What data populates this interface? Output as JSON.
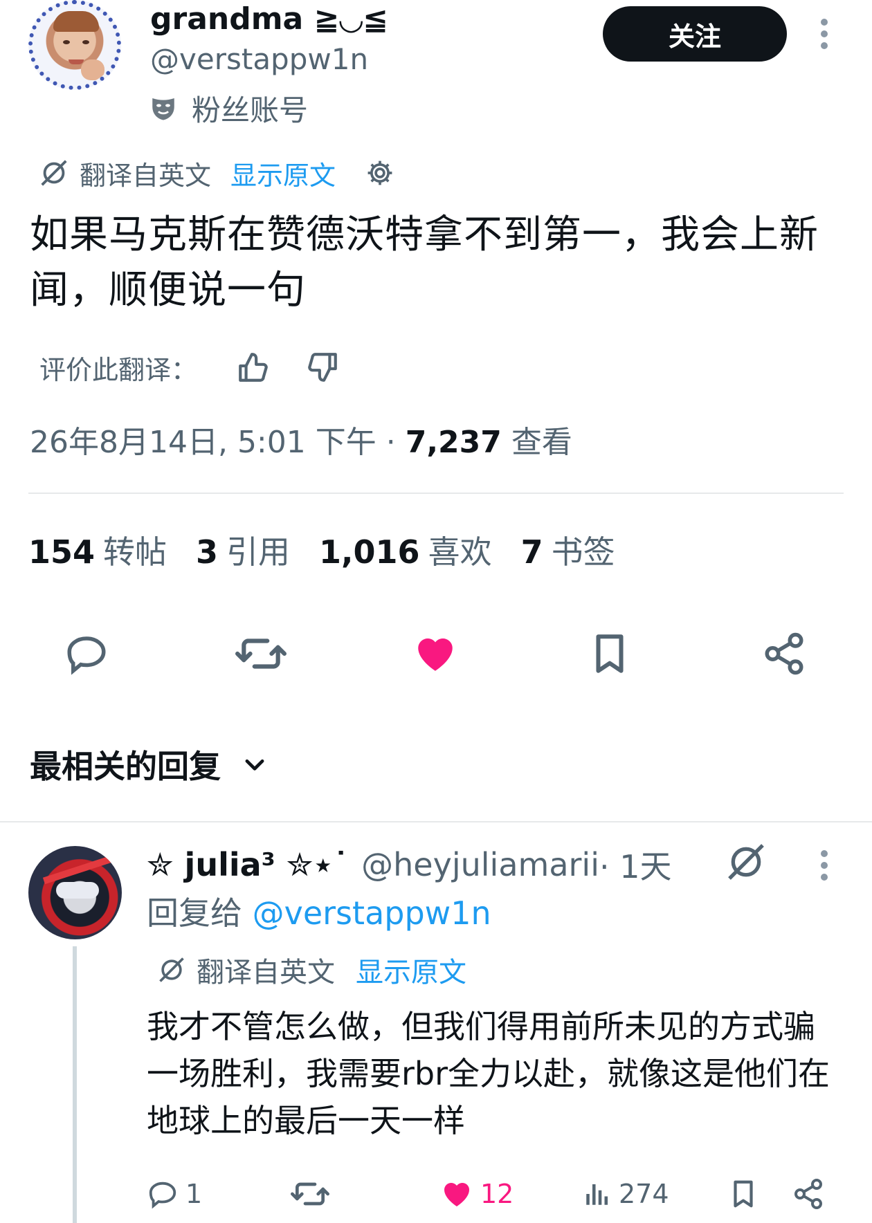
{
  "author": {
    "display_name": "grandma ≧◡≦",
    "handle": "@verstappw1n",
    "fan_label": "粉丝账号",
    "follow_label": "关注"
  },
  "translation": {
    "note": "翻译自英文",
    "show_original": "显示原文"
  },
  "tweet": {
    "text": "如果马克斯在赞德沃特拿不到第一，我会上新闻，顺便说一句",
    "rate_label": "评价此翻译：",
    "timestamp": "26年8月14日, 5:01 下午",
    "separator": " · ",
    "views_count": "7,237",
    "views_label": "查看"
  },
  "stats": [
    {
      "count": "154",
      "label": "转帖"
    },
    {
      "count": "3",
      "label": "引用"
    },
    {
      "count": "1,016",
      "label": "喜欢"
    },
    {
      "count": "7",
      "label": "书签"
    }
  ],
  "sort_label": "最相关的回复",
  "reply": {
    "display_name": "✮ julia³ ✮⋆˙",
    "handle": "@heyjuliamarii",
    "time": " · 1天",
    "reply_to_prefix": "回复给 ",
    "reply_to_handle": "@verstappw1n",
    "translation_note": "翻译自英文",
    "show_original": "显示原文",
    "text": "我才不管怎么做，但我们得用前所未见的方式骗一场胜利，我需要rbr全力以赴，就像这是他们在地球上的最后一天一样",
    "replies": "1",
    "likes": "12",
    "views": "274"
  },
  "colors": {
    "text": "#0f1419",
    "secondary": "#536471",
    "link": "#1d9bf0",
    "like": "#f91880",
    "button_bg": "#0f1419"
  },
  "icons": [
    "translate-icon",
    "gear-icon",
    "thumbs-up-icon",
    "thumbs-down-icon",
    "comment-icon",
    "retweet-icon",
    "heart-icon",
    "bookmark-icon",
    "share-icon",
    "chevron-down-icon",
    "more-icon",
    "views-icon",
    "mask-icon"
  ]
}
